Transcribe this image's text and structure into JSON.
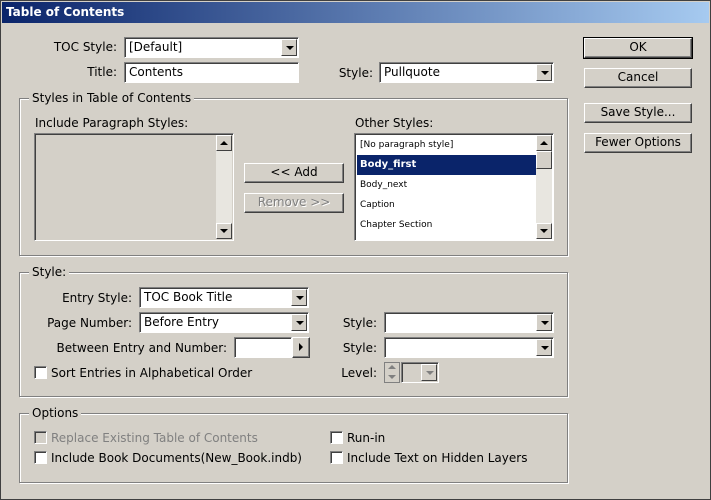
{
  "window": {
    "title": "Table of Contents"
  },
  "buttons": {
    "ok": "OK",
    "cancel": "Cancel",
    "save_style": "Save Style...",
    "fewer_options": "Fewer Options",
    "add": "<< Add",
    "remove": "Remove >>"
  },
  "toc": {
    "style_label": "TOC Style:",
    "style_value": "[Default]",
    "title_label": "Title:",
    "title_value": "Contents",
    "title_style_label": "Style:",
    "title_style_value": "Pullquote"
  },
  "styles_group": {
    "title": "Styles in Table of Contents",
    "include_label": "Include Paragraph Styles:",
    "other_label": "Other Styles:",
    "other_styles": [
      "[No paragraph style]",
      "Body_first",
      "Body_next",
      "Caption",
      "Chapter Section"
    ],
    "selected_index": 1
  },
  "style_group": {
    "title": "Style:",
    "entry_style_label": "Entry Style:",
    "entry_style_value": "TOC Book Title",
    "page_number_label": "Page Number:",
    "page_number_value": "Before Entry",
    "page_number_style_label": "Style:",
    "page_number_style_value": "",
    "between_label": "Between Entry and Number:",
    "between_value": "",
    "between_style_label": "Style:",
    "between_style_value": "",
    "sort_label": "Sort Entries in Alphabetical Order",
    "sort_checked": false,
    "level_label": "Level:",
    "level_value": ""
  },
  "options_group": {
    "title": "Options",
    "replace_label": "Replace Existing Table of Contents",
    "include_book_label": "Include Book Documents(New_Book.indb)",
    "run_in_label": "Run-in",
    "hidden_layers_label": "Include Text on Hidden Layers"
  }
}
